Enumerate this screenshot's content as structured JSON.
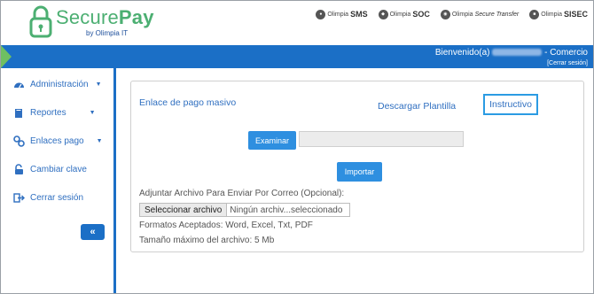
{
  "brand": {
    "name_part1": "Secure",
    "name_part2": "Pay",
    "byline": "by Olimpia IT"
  },
  "partners": [
    {
      "small": "Olimpia",
      "big": "SMS"
    },
    {
      "small": "Olimpia",
      "big": "SOC"
    },
    {
      "small": "Olimpia",
      "big": "Secure Transfer"
    },
    {
      "small": "Olimpia",
      "big": "SISEC"
    }
  ],
  "topbar": {
    "welcome_prefix": "Bienvenido(a)",
    "role": "- Comercio",
    "logout": "[Cerrar sesión]"
  },
  "sidebar": {
    "items": [
      {
        "label": "Administración",
        "icon": "dashboard-icon"
      },
      {
        "label": "Reportes",
        "icon": "book-icon"
      },
      {
        "label": "Enlaces pago",
        "icon": "link-icon"
      },
      {
        "label": "Cambiar clave",
        "icon": "unlock-icon"
      },
      {
        "label": "Cerrar sesión",
        "icon": "sign-out-icon"
      }
    ],
    "collapse": "«"
  },
  "main": {
    "title": "Enlace de pago masivo",
    "download": "Descargar Plantilla",
    "instructivo": "Instructivo",
    "examinar": "Examinar",
    "importar": "Importar",
    "attach_label": "Adjuntar Archivo Para Enviar Por Correo (Opcional):",
    "choose_file": "Seleccionar archivo",
    "no_file": "Ningún archiv...seleccionado",
    "formats": "Formatos Aceptados: Word, Excel, Txt, PDF",
    "max_size": "Tamaño máximo del archivo: 5 Mb"
  },
  "colors": {
    "primary": "#1b6fc6",
    "brand_green": "#4caf72",
    "accent": "#2b9be3"
  }
}
